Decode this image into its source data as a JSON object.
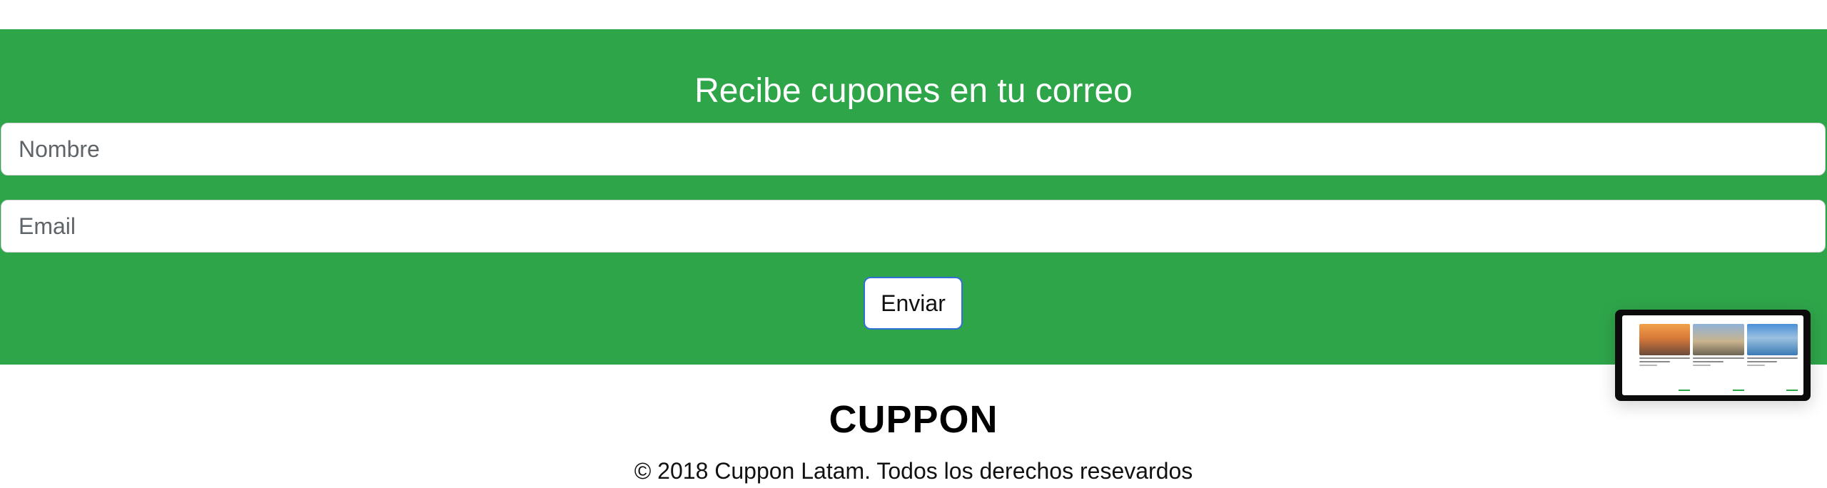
{
  "newsletter": {
    "title": "Recibe cupones en tu correo",
    "name_placeholder": "Nombre",
    "email_placeholder": "Email",
    "submit_label": "Enviar",
    "background_color": "#2fa54a"
  },
  "footer": {
    "brand": "CUPPON",
    "copyright": "© 2018 Cuppon Latam. Todos los derechos resevardos"
  }
}
